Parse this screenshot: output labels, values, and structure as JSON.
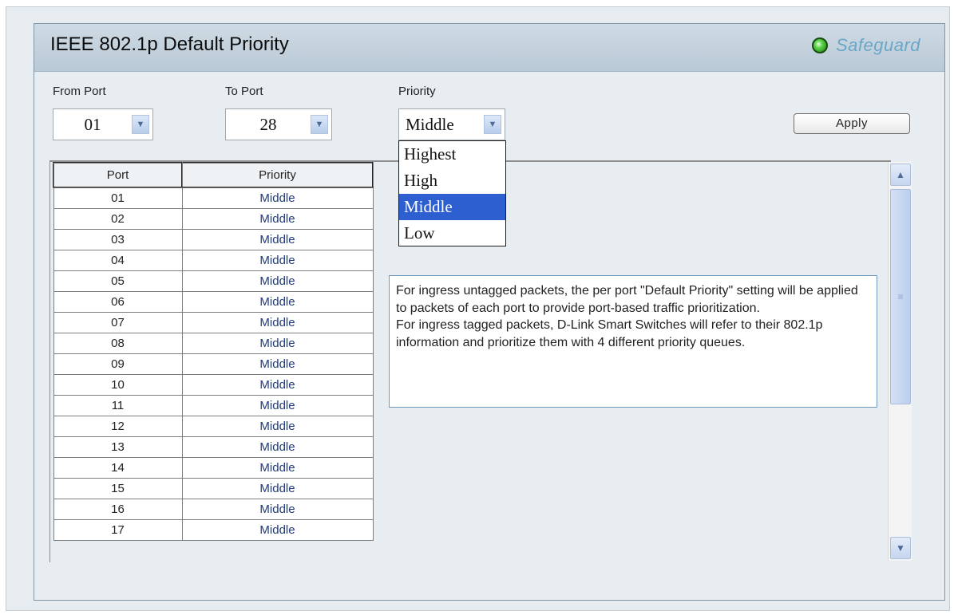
{
  "panel": {
    "title": "IEEE 802.1p Default Priority",
    "safeguard_label": "Safeguard",
    "safeguard_status_color": "#3cbf2a"
  },
  "form": {
    "from_port": {
      "label": "From Port",
      "value": "01"
    },
    "to_port": {
      "label": "To Port",
      "value": "28"
    },
    "priority": {
      "label": "Priority",
      "value": "Middle",
      "options": [
        "Highest",
        "High",
        "Middle",
        "Low"
      ],
      "highlighted": "Middle"
    },
    "apply_label": "Apply"
  },
  "table": {
    "headers": [
      "Port",
      "Priority"
    ],
    "rows": [
      [
        "01",
        "Middle"
      ],
      [
        "02",
        "Middle"
      ],
      [
        "03",
        "Middle"
      ],
      [
        "04",
        "Middle"
      ],
      [
        "05",
        "Middle"
      ],
      [
        "06",
        "Middle"
      ],
      [
        "07",
        "Middle"
      ],
      [
        "08",
        "Middle"
      ],
      [
        "09",
        "Middle"
      ],
      [
        "10",
        "Middle"
      ],
      [
        "11",
        "Middle"
      ],
      [
        "12",
        "Middle"
      ],
      [
        "13",
        "Middle"
      ],
      [
        "14",
        "Middle"
      ],
      [
        "15",
        "Middle"
      ],
      [
        "16",
        "Middle"
      ],
      [
        "17",
        "Middle"
      ]
    ]
  },
  "info": {
    "untagged": "For ingress untagged packets, the per port \"Default Priority\" setting will be applied to packets of each port to provide port-based traffic prioritization.",
    "tagged": "For ingress tagged packets, D-Link Smart Switches will refer to their 802.1p information and prioritize them with 4 different priority queues."
  },
  "icons": {
    "dropdown_arrow": "chevron-down-icon",
    "scroll_up": "chevron-up-icon",
    "scroll_down": "chevron-down-icon",
    "status": "status-dot-icon"
  }
}
